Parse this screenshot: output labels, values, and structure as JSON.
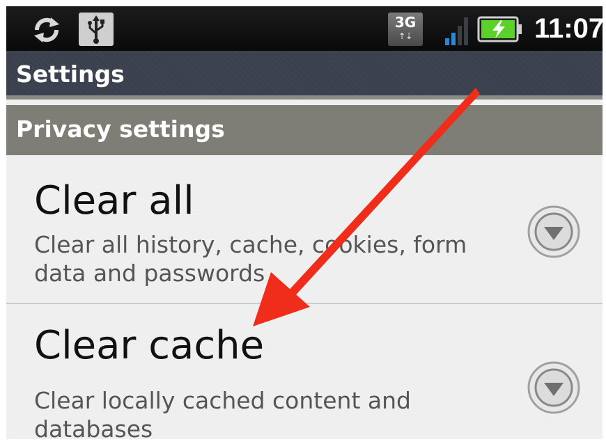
{
  "status_bar": {
    "network_type": "3G",
    "network_arrows": "⇡⇣",
    "clock": "11:07",
    "icons": [
      "sync-icon",
      "usb-icon",
      "network-3g-icon",
      "signal-icon",
      "battery-charging-icon"
    ]
  },
  "title_bar": {
    "title": "Settings"
  },
  "section": {
    "label": "Privacy settings"
  },
  "items": [
    {
      "title": "Clear all",
      "description": "Clear all history, cache, cookies, form data and passwords"
    },
    {
      "title": "Clear cache",
      "description": "Clear locally cached content and databases"
    }
  ],
  "colors": {
    "annotation_arrow": "#f02d1a",
    "battery": "#5bd22a",
    "signal": "#2a86d6"
  }
}
